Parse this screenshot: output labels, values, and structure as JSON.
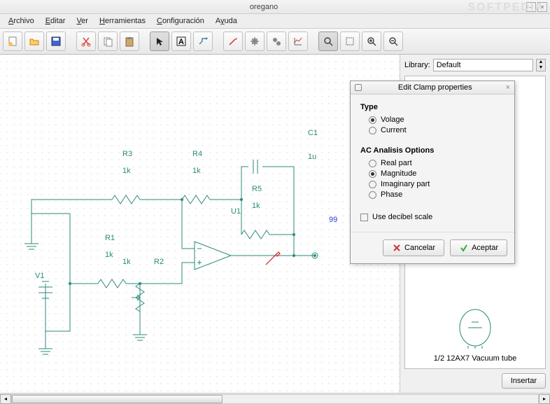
{
  "window": {
    "title": "oregano",
    "watermark": "SOFTPEDIA"
  },
  "menu": {
    "archivo": "Archivo",
    "editar": "Editar",
    "ver": "Ver",
    "herramientas": "Herramientas",
    "configuracion": "Configuración",
    "ayuda": "Ayuda"
  },
  "toolbar": {
    "new": "new-icon",
    "open": "open-icon",
    "save": "save-icon",
    "cut": "cut-icon",
    "copy": "copy-icon",
    "paste": "paste-icon",
    "arrow": "arrow-icon",
    "text": "text-icon",
    "wire": "wire-icon",
    "probe": "probe-icon",
    "sim": "gear-icon",
    "params": "gears-icon",
    "plot": "plot-icon",
    "zoom": "zoom-icon",
    "region": "region-icon",
    "zoomin": "zoomin-icon",
    "zoomout": "zoomout-icon"
  },
  "sidebar": {
    "library_label": "Library:",
    "library_value": "Default",
    "preview_label": "1/2 12AX7 Vacuum tube",
    "insert_btn": "Insertar"
  },
  "dialog": {
    "title": "Edit Clamp properties",
    "type_label": "Type",
    "type_options": {
      "voltage": "Volage",
      "current": "Current"
    },
    "type_selected": "voltage",
    "ac_label": "AC Analisis Options",
    "ac_options": {
      "real": "Real part",
      "magnitude": "Magnitude",
      "imaginary": "Imaginary part",
      "phase": "Phase"
    },
    "ac_selected": "magnitude",
    "decibel": "Use decibel scale",
    "cancel": "Cancelar",
    "accept": "Aceptar"
  },
  "schematic": {
    "node_label": "99",
    "components": {
      "C1": {
        "name": "C1",
        "value": "1u"
      },
      "R1": {
        "name": "R1",
        "value": "1k"
      },
      "R2": {
        "name": "R2",
        "value": "1k"
      },
      "R3": {
        "name": "R3",
        "value": "1k"
      },
      "R4": {
        "name": "R4",
        "value": "1k"
      },
      "R5": {
        "name": "R5",
        "value": "1k"
      },
      "U1": {
        "name": "U1"
      },
      "V1": {
        "name": "V1"
      }
    }
  }
}
